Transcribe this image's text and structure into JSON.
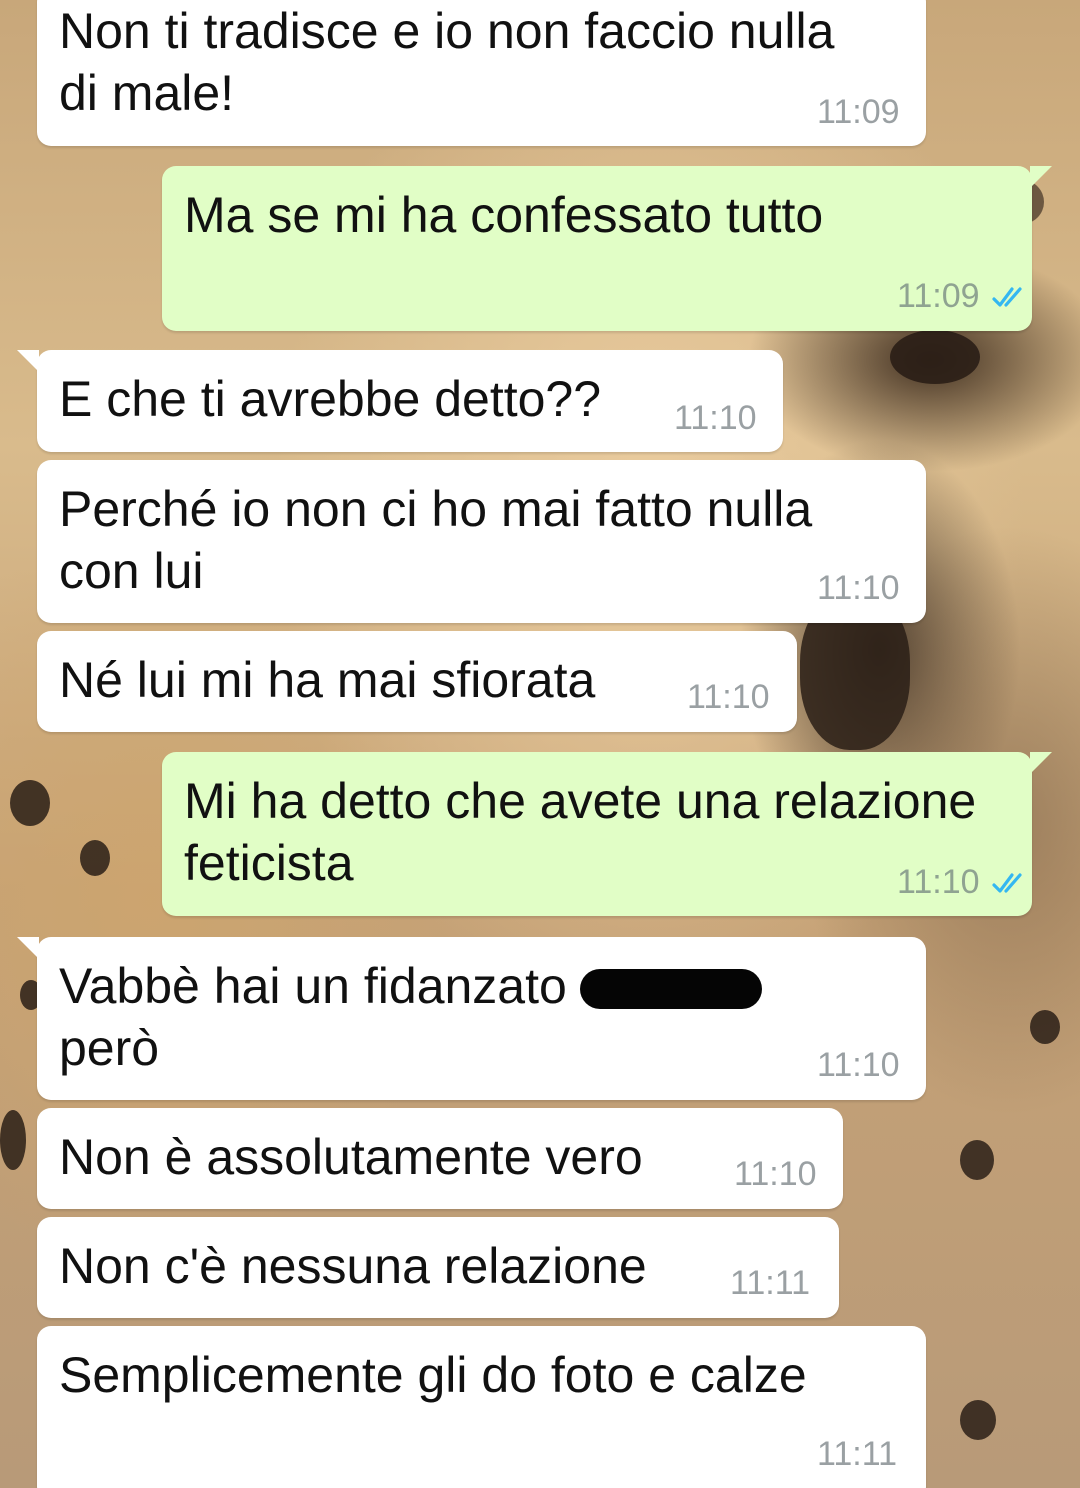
{
  "messages": [
    {
      "direction": "incoming",
      "text": "Non ti tradisce e io non faccio nulla\ndi male!",
      "time": "11:09"
    },
    {
      "direction": "outgoing",
      "text": "Ma se mi ha confessato tutto",
      "time": "11:09",
      "status": "read"
    },
    {
      "direction": "incoming",
      "text": "E che ti avrebbe detto??",
      "time": "11:10"
    },
    {
      "direction": "incoming",
      "text": "Perché io non ci ho mai fatto nulla\ncon lui",
      "time": "11:10"
    },
    {
      "direction": "incoming",
      "text": "Né lui mi ha mai sfiorata",
      "time": "11:10"
    },
    {
      "direction": "outgoing",
      "text": "Mi ha detto che avete una relazione\nfeticista",
      "time": "11:10",
      "status": "read"
    },
    {
      "direction": "incoming",
      "text_before_redaction": "Vabbè hai un fidanzato c",
      "text_after_redaction": "però",
      "time": "11:10"
    },
    {
      "direction": "incoming",
      "text": "Non è assolutamente vero",
      "time": "11:10"
    },
    {
      "direction": "incoming",
      "text": "Non c'è nessuna relazione",
      "time": "11:11"
    },
    {
      "direction": "incoming",
      "text": "Semplicemente gli do foto e calze",
      "time": "11:11"
    }
  ],
  "colors": {
    "incoming_bubble": "#ffffff",
    "outgoing_bubble": "#e1fec6",
    "read_ticks": "#34b7f1",
    "timestamp": "#9aa0a3"
  },
  "icons": {
    "read_receipt": "double-check-icon"
  }
}
